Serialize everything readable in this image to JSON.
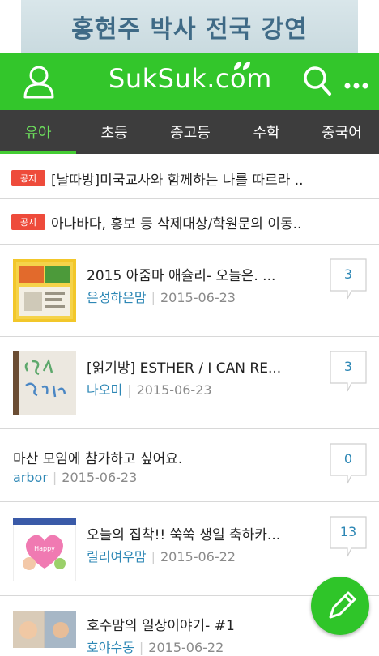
{
  "banner": {
    "text": "홍현주 박사 전국 강연"
  },
  "header": {
    "logo": "SukSuk.com"
  },
  "tabs": [
    {
      "label": "유아",
      "active": true
    },
    {
      "label": "초등",
      "active": false
    },
    {
      "label": "중고등",
      "active": false
    },
    {
      "label": "수학",
      "active": false
    },
    {
      "label": "중국어",
      "active": false
    }
  ],
  "notices": [
    {
      "tag": "공지",
      "title": "[날따방]미국교사와 함께하는 나를 따르라 .."
    },
    {
      "tag": "공지",
      "title": "아나바다, 홍보 등 삭제대상/학원문의 이동.."
    }
  ],
  "posts": [
    {
      "title": "2015 아줌마 애슐리- 오늘은. ...",
      "author": "은성하은맘",
      "date": "2015-06-23",
      "comments": "3",
      "thumb": "yellow-book"
    },
    {
      "title": "[읽기방] ESTHER / I CAN RE...",
      "author": "나오미",
      "date": "2015-06-23",
      "comments": "3",
      "thumb": "whiteboard"
    },
    {
      "title": "마산 모임에 참가하고 싶어요.",
      "author": "arbor",
      "date": "2015-06-23",
      "comments": "0",
      "thumb": ""
    },
    {
      "title": "오늘의 집착!! 쑥쑥 생일 축하카...",
      "author": "릴리여우맘",
      "date": "2015-06-22",
      "comments": "13",
      "thumb": "birthday-card"
    },
    {
      "title": "호수맘의 일상이야기- #1",
      "author": "호야수동",
      "date": "2015-06-22",
      "comments": "",
      "thumb": "photos"
    }
  ],
  "colors": {
    "brand": "#33c62b",
    "tabbar": "#3d3d3d",
    "notice": "#ee4b3b",
    "author": "#2d87b5"
  }
}
